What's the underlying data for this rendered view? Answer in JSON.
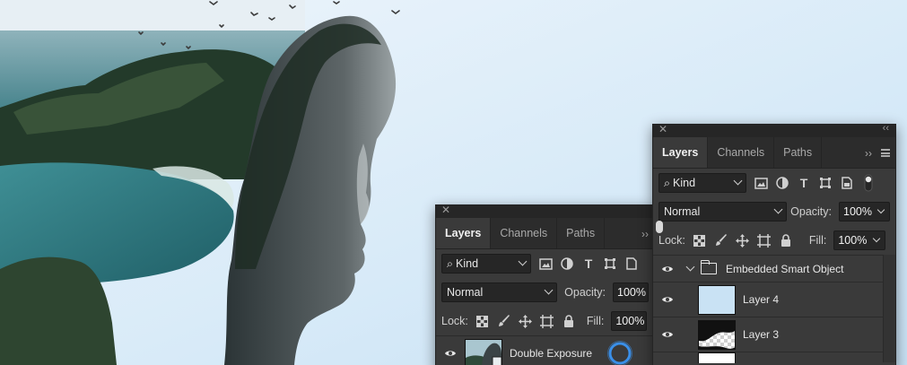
{
  "panel_back": {
    "tabs": [
      {
        "label": "Layers",
        "active": true
      },
      {
        "label": "Channels",
        "active": false
      },
      {
        "label": "Paths",
        "active": false
      }
    ],
    "filter_kind": "Kind",
    "blend_mode": "Normal",
    "opacity_label": "Opacity:",
    "opacity_value": "100%",
    "lock_label": "Lock:",
    "fill_label": "Fill:",
    "fill_value": "100%",
    "layers": [
      {
        "name": "Double Exposure"
      }
    ]
  },
  "panel_front": {
    "tabs": [
      {
        "label": "Layers",
        "active": true
      },
      {
        "label": "Channels",
        "active": false
      },
      {
        "label": "Paths",
        "active": false
      }
    ],
    "filter_kind": "Kind",
    "blend_mode": "Normal",
    "opacity_label": "Opacity:",
    "opacity_value": "100%",
    "lock_label": "Lock:",
    "fill_label": "Fill:",
    "fill_value": "100%",
    "group_name": "Embedded Smart Object",
    "layers": [
      {
        "name": "Layer 4"
      },
      {
        "name": "Layer 3"
      }
    ]
  },
  "icons": [
    "close-icon",
    "collapse-icon",
    "panel-menu-icon",
    "search-icon",
    "eye-icon",
    "folder-icon",
    "chevron-down-icon"
  ],
  "colors": {
    "panel_bg": "#3a3a3a",
    "tab_bar_bg": "#2c2c2c",
    "field_bg": "#262626",
    "sky": "#d6e9f7",
    "selection_ring": "#3a8fe8"
  }
}
